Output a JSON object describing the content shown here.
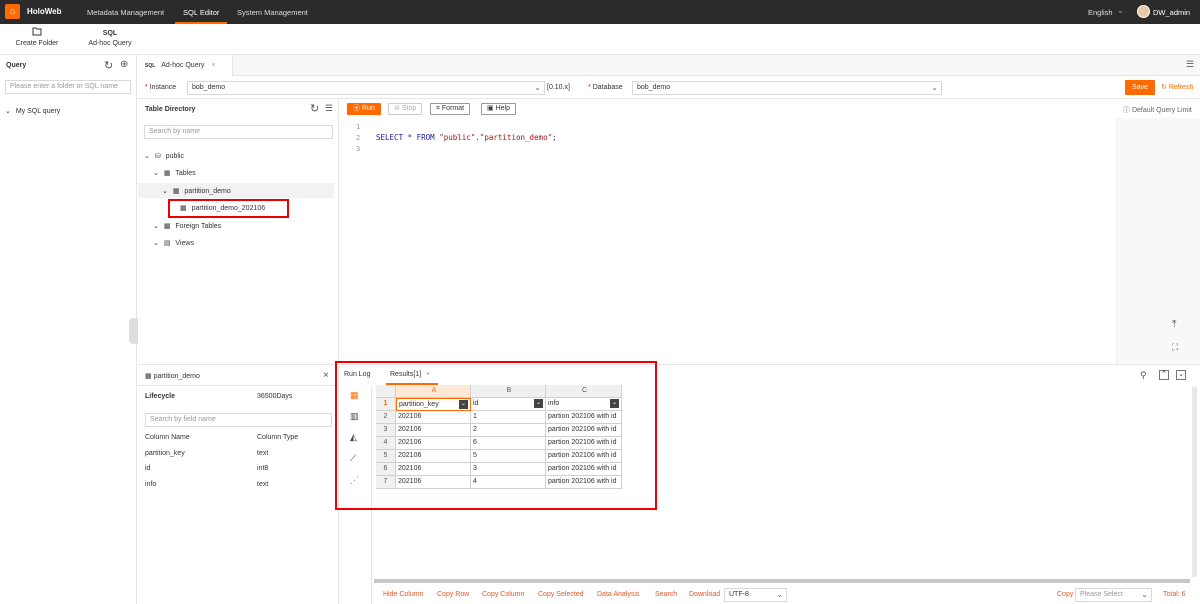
{
  "nav": {
    "brand": "HoloWeb",
    "items": [
      "Metadata Management",
      "SQL Editor",
      "System Management"
    ],
    "language": "English",
    "user": "DW_admin"
  },
  "toolbar": {
    "create_folder": "Create Folder",
    "adhoc_query_icon": "SQL",
    "adhoc_query": "Ad-hoc Query"
  },
  "left": {
    "title": "Query",
    "search_placeholder": "Please enter a folder or SQL name",
    "tree_item": "My SQL query"
  },
  "tab": {
    "label": "Ad-hoc Query",
    "icon_text": "SQL"
  },
  "instance": {
    "label": "Instance",
    "value": "bob_demo",
    "version": "[0.10.x]",
    "db_label": "Database",
    "db_value": "bob_demo",
    "save": "Save",
    "refresh": "Refresh"
  },
  "tabledir": {
    "title": "Table Directory",
    "search_placeholder": "Search by name",
    "schema": "public",
    "tables": "Tables",
    "table": "partition_demo",
    "child_table": "partition_demo_202106",
    "foreign": "Foreign Tables",
    "views": "Views"
  },
  "editor": {
    "run": "Run",
    "stop": "Stop",
    "format": "Format",
    "help": "Help",
    "limit": "Default Query Limit",
    "lines": [
      "1",
      "2",
      "3"
    ],
    "sql_keyword": "SELECT * FROM ",
    "sql_string": "\"public\".\"partition_demo\"",
    "sql_end": ";"
  },
  "tableinfo": {
    "name": "partition_demo",
    "lifecycle_label": "Lifecycle",
    "lifecycle_value": "36500Days",
    "search_placeholder": "Search by field name",
    "col_name": "Column Name",
    "col_type": "Column Type",
    "columns": [
      {
        "name": "partition_key",
        "type": "text"
      },
      {
        "name": "id",
        "type": "int8"
      },
      {
        "name": "info",
        "type": "text"
      }
    ]
  },
  "results": {
    "tab_log": "Run Log",
    "tab_results": "Results[1]",
    "col_letters": [
      "A",
      "B",
      "C"
    ],
    "headers": [
      "partition_key",
      "id",
      "info"
    ],
    "rownums": [
      "1",
      "2",
      "3",
      "4",
      "5",
      "6",
      "7"
    ],
    "rows": [
      [
        "202106",
        "1",
        "partion 202106 with id"
      ],
      [
        "202106",
        "2",
        "partion 202106 with id"
      ],
      [
        "202106",
        "6",
        "partion 202106 with id"
      ],
      [
        "202106",
        "5",
        "partion 202106 with id"
      ],
      [
        "202106",
        "3",
        "partion 202106 with id"
      ],
      [
        "202106",
        "4",
        "partion 202106 with id"
      ]
    ],
    "footer": {
      "hide_column": "Hide Column",
      "copy_row": "Copy Row",
      "copy_column": "Copy Column",
      "copy_selected": "Copy Selected",
      "data_analysis": "Data Analysis",
      "search": "Search",
      "download": "Download",
      "encoding": "UTF-8",
      "copy": "Copy",
      "copy_placeholder": "Please Select",
      "total": "Total: 6"
    }
  },
  "colors": {
    "accent": "#ff6a00",
    "nav_bg": "#2b2b2b",
    "highlight": "#e00000"
  }
}
